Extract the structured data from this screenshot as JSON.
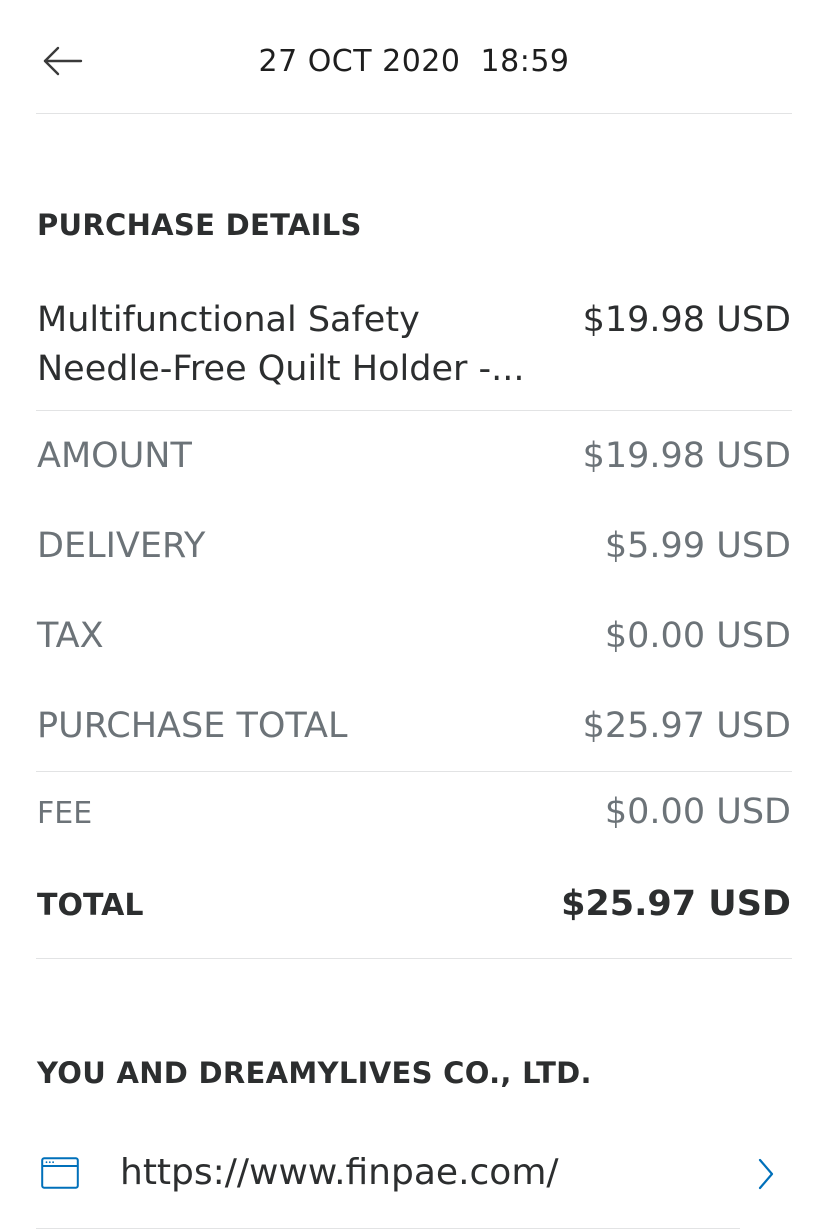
{
  "header": {
    "title": "27 OCT 2020  18:59",
    "back_icon": "arrow-left-icon"
  },
  "purchase_details": {
    "heading": "PURCHASE DETAILS",
    "item": {
      "name_line1": "Multifunctional Safety",
      "name_line2": "Needle-Free Quilt Holder -...",
      "price": "$19.98 USD"
    },
    "amount": {
      "label": "AMOUNT",
      "value": "$19.98 USD"
    },
    "delivery": {
      "label": "DELIVERY",
      "value": "$5.99 USD"
    },
    "tax": {
      "label": "TAX",
      "value": "$0.00 USD"
    },
    "purchase_total": {
      "label": "PURCHASE TOTAL",
      "value": "$25.97 USD"
    },
    "fee": {
      "label": "FEE",
      "value": "$0.00 USD"
    },
    "total": {
      "label": "TOTAL",
      "value": "$25.97 USD"
    }
  },
  "merchant": {
    "heading": "YOU AND DREAMYLIVES CO., LTD.",
    "website": "https://www.finpae.com/",
    "website_icon": "browser-window-icon",
    "chevron_icon": "chevron-right-icon"
  },
  "colors": {
    "text_primary": "#2c2e2f",
    "text_secondary": "#6c7378",
    "divider": "#e2e3e4",
    "accent": "#0070ba"
  }
}
